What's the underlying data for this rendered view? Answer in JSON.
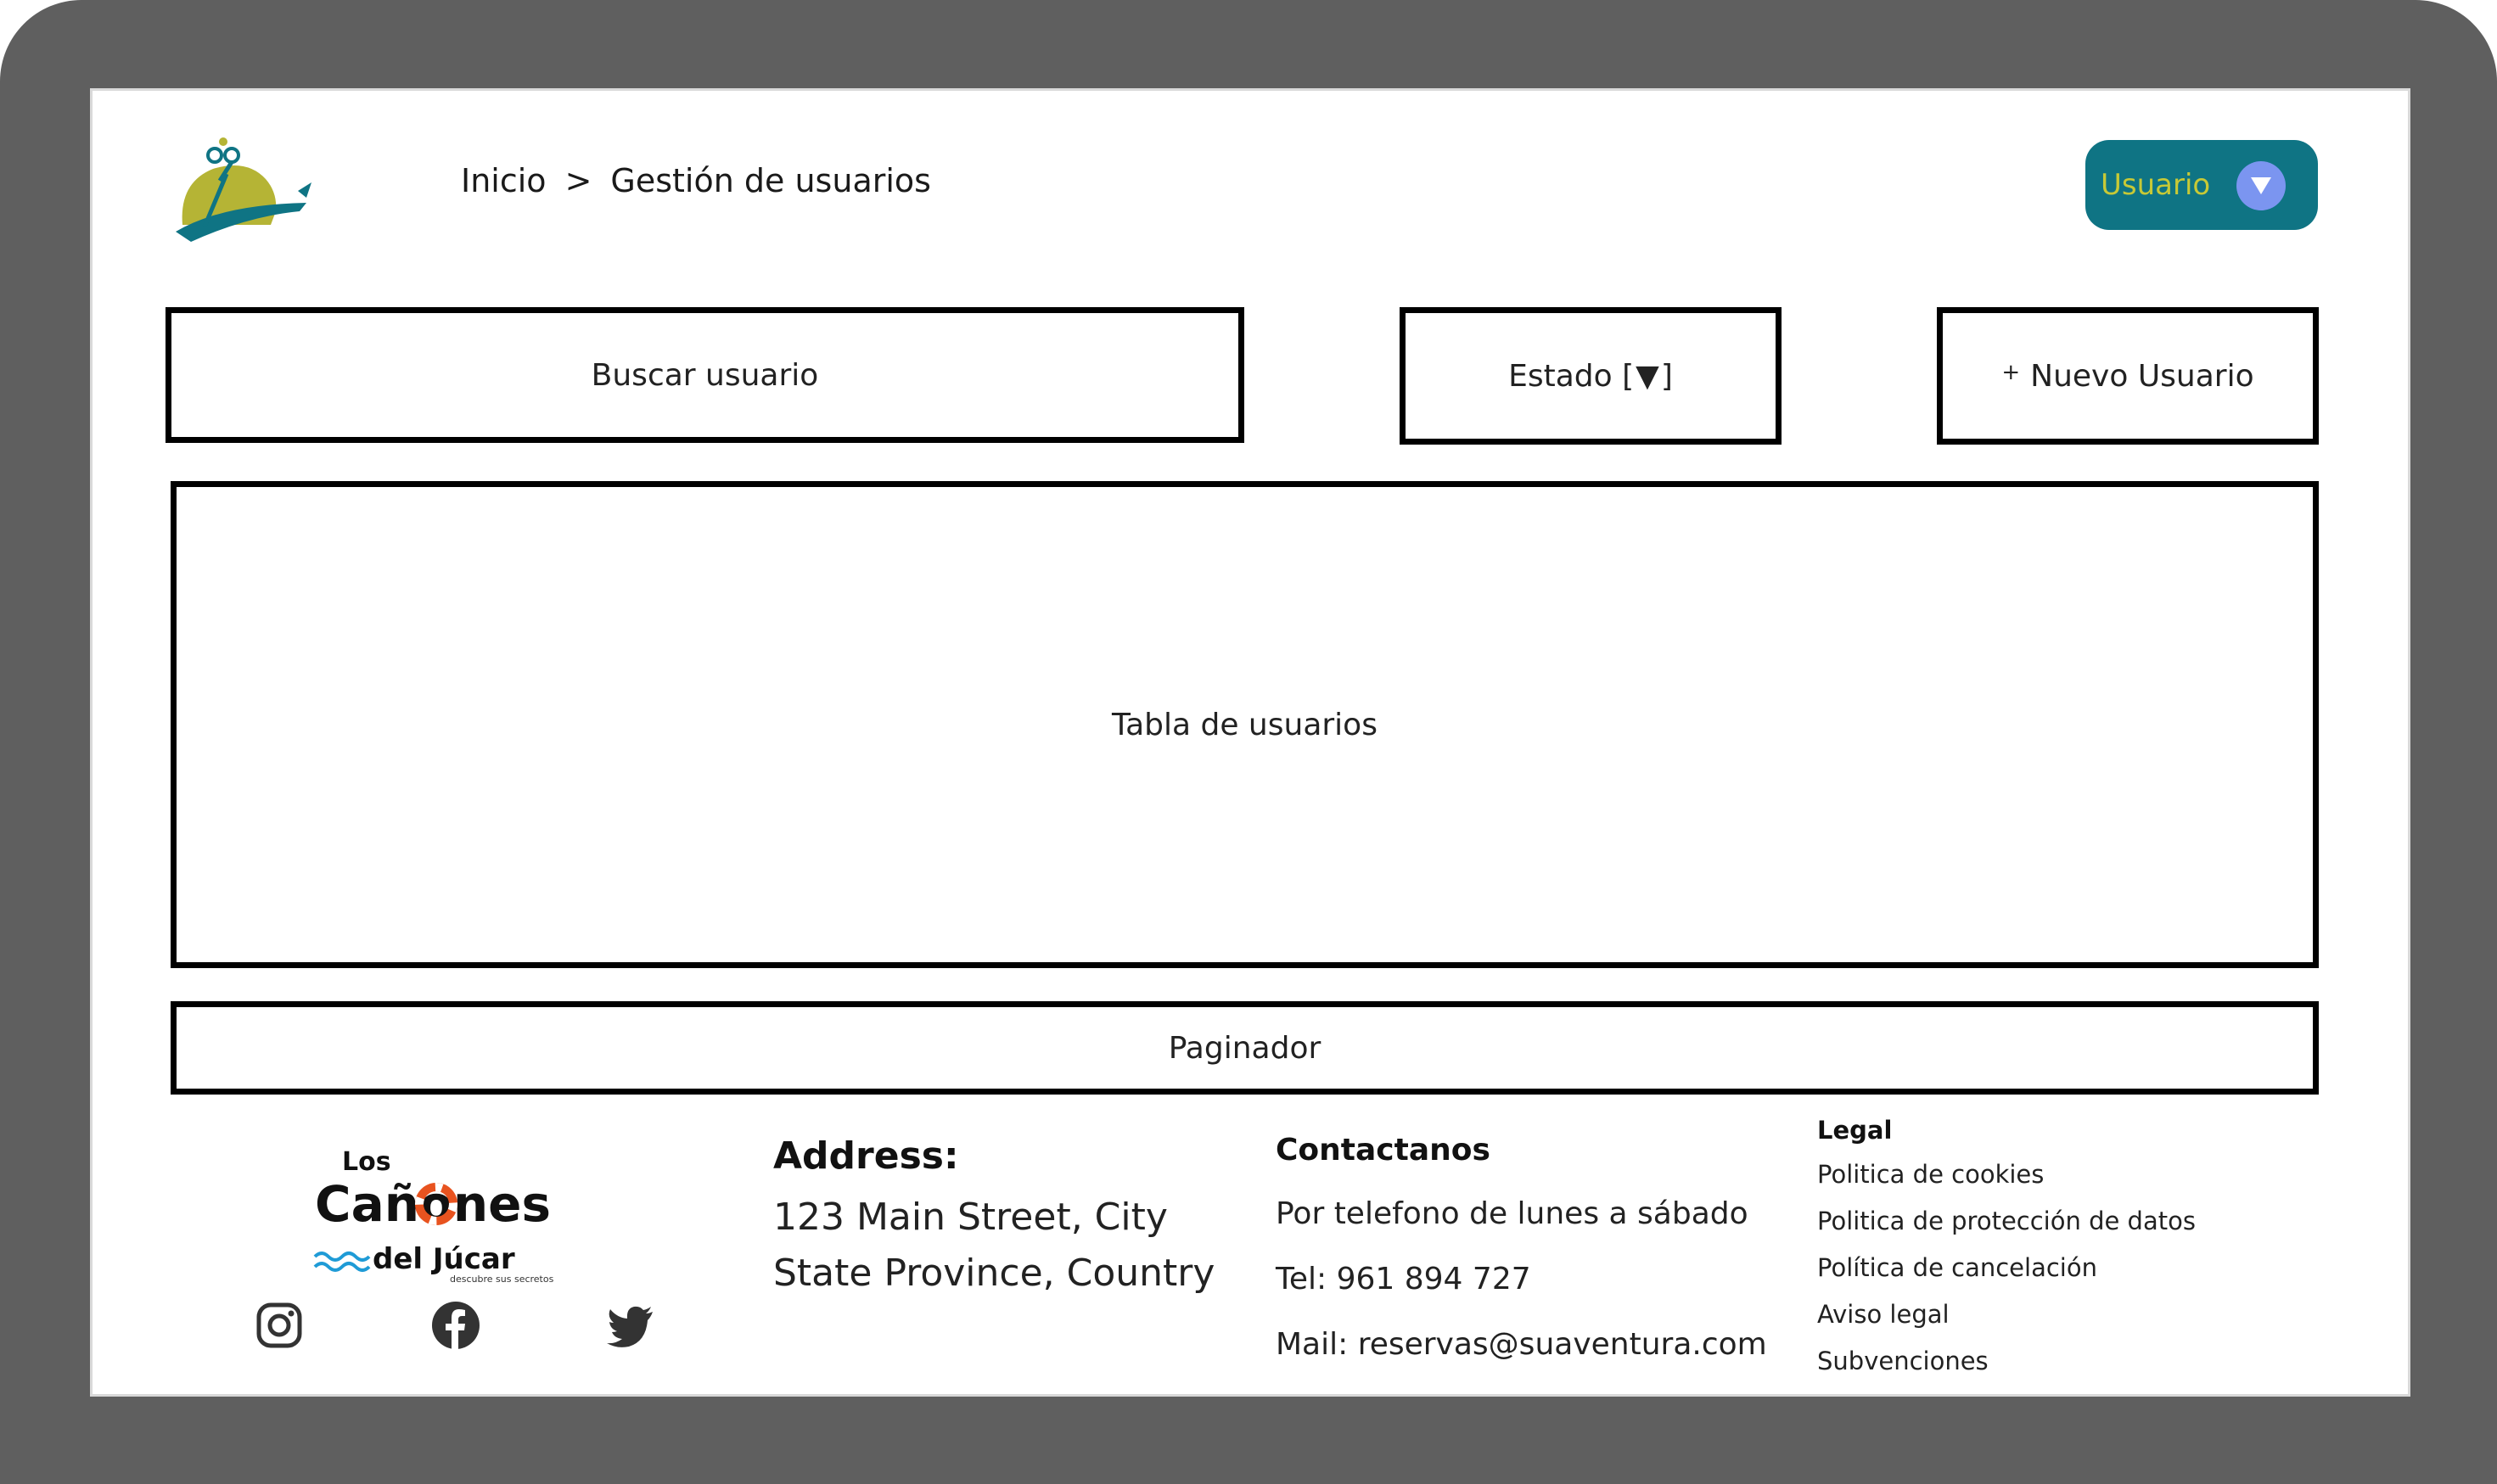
{
  "breadcrumb": {
    "home": "Inicio",
    "separator": ">",
    "current": "Gestión de usuarios"
  },
  "user_menu": {
    "label": "Usuario"
  },
  "toolbar": {
    "search_label": "Buscar usuario",
    "estado_label": "Estado [",
    "estado_suffix": "]",
    "estado_icon": "▼",
    "new_user_plus": "+",
    "new_user_label": "Nuevo Usuario"
  },
  "main": {
    "table_label": "Tabla de usuarios",
    "paginator_label": "Paginador"
  },
  "footer": {
    "brand": {
      "line1": "Los",
      "line2": "Cañones",
      "line3": "del Júcar",
      "tagline": "descubre sus secretos"
    },
    "address": {
      "heading": "Address:",
      "line1": "123 Main Street, City",
      "line2": "State Province, Country"
    },
    "contact": {
      "heading": "Contactanos",
      "hours": "Por telefono de lunes a sábado",
      "phone": "Tel: 961 894 727",
      "mail": "Mail: reservas@suaventura.com"
    },
    "legal": {
      "heading": "Legal",
      "links": [
        "Politica de cookies",
        "Politica de protección de datos",
        "Política de cancelación",
        "Aviso legal",
        "Subvenciones"
      ]
    },
    "social": [
      "instagram-icon",
      "facebook-icon",
      "twitter-icon"
    ]
  },
  "colors": {
    "frame": "#5f5f5f",
    "user_button_bg": "#0f7484",
    "user_button_text": "#c7c936",
    "user_button_circle": "#7b95f0",
    "logo_olive": "#b5b435",
    "logo_teal": "#0f7484"
  }
}
